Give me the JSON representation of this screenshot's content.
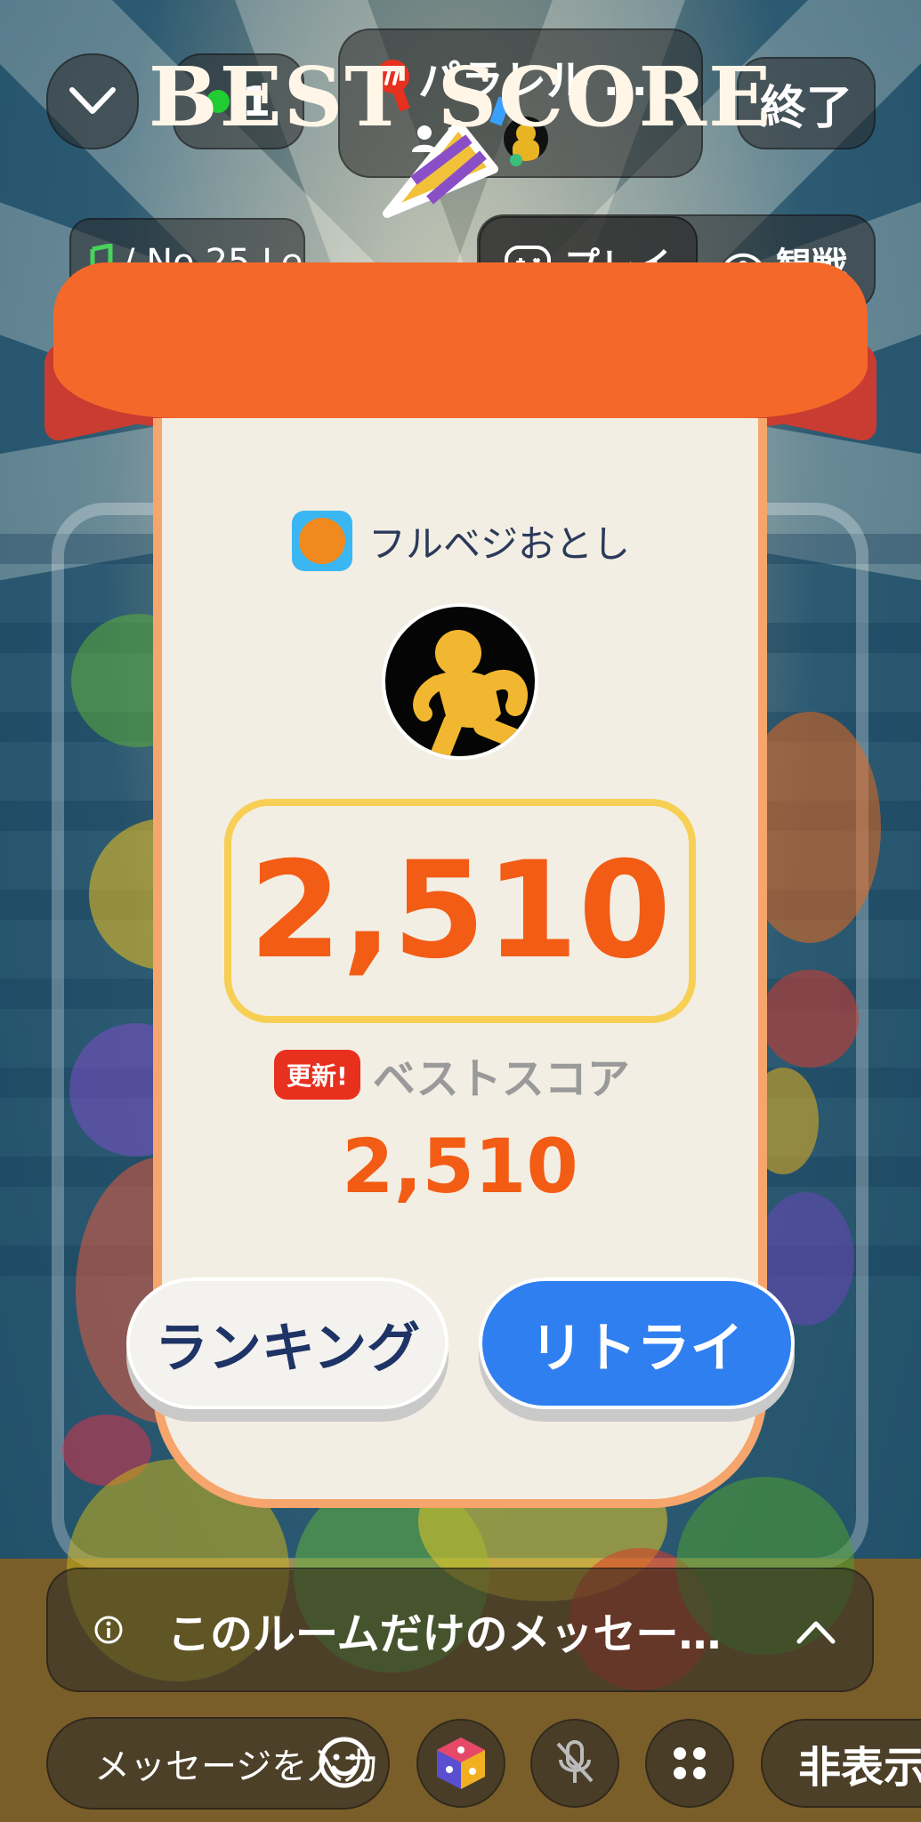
{
  "top_bar": {
    "online_count": "1",
    "room_title": "パラレル …",
    "room_members": "1",
    "end_label": "終了"
  },
  "music": {
    "track_label": "/ No.25 Le"
  },
  "mode_tabs": {
    "play_label": "プレイ",
    "watch_label": "観戦"
  },
  "banner": {
    "title": "BEST SCORE"
  },
  "result_card": {
    "game_name": "フルベジおとし",
    "score": "2,510",
    "updated_badge": "更新!",
    "best_score_label": "ベストスコア",
    "best_score_value": "2,510",
    "ranking_button": "ランキング",
    "retry_button": "リトライ"
  },
  "message_bar": {
    "text": "このルームだけのメッセー…"
  },
  "bottom_bar": {
    "input_placeholder": "メッセージを入力",
    "hide_label": "非表示"
  },
  "colors": {
    "banner_orange": "#f4692a",
    "score_orange": "#f25c15",
    "retry_blue": "#2f7ff0",
    "online_green": "#22cc33",
    "updated_red": "#e8301e"
  }
}
